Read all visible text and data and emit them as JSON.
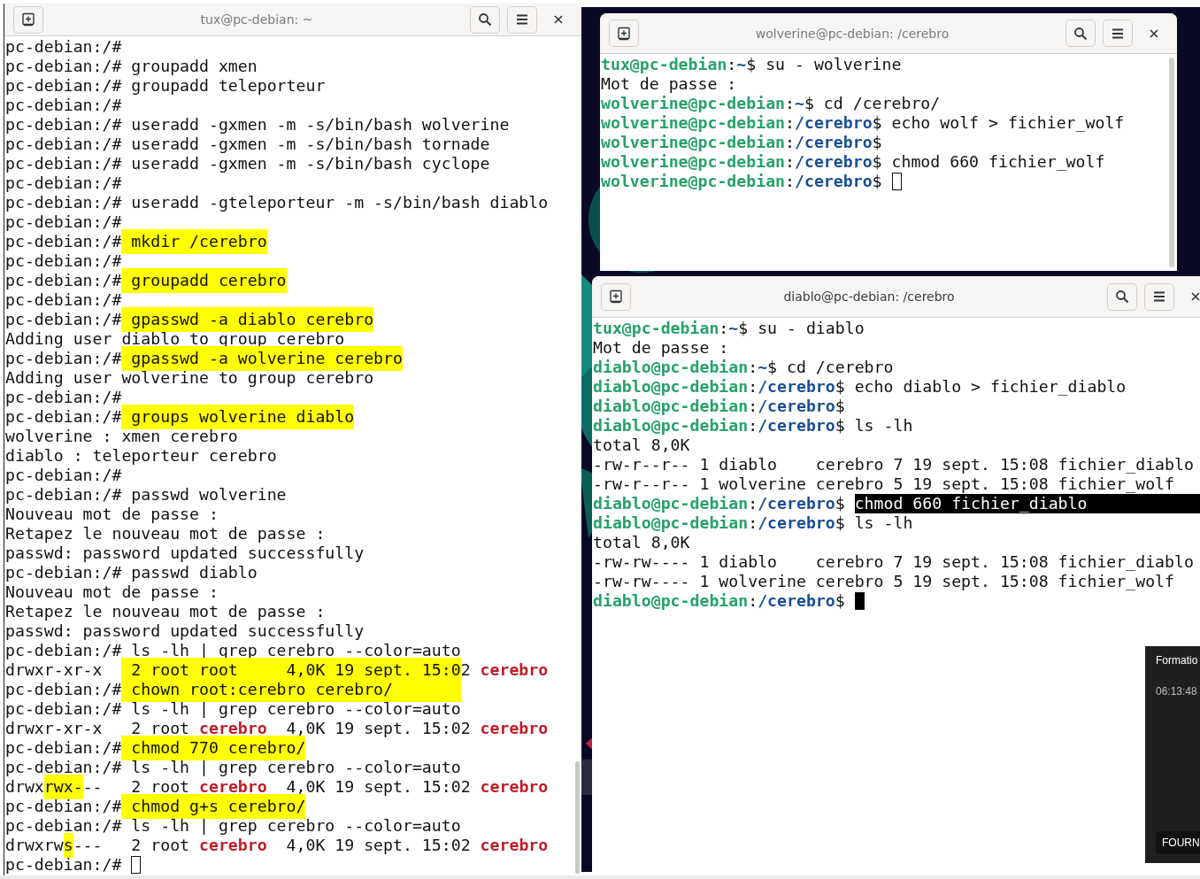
{
  "windows": [
    {
      "title": "tux@pc-debian: ~",
      "lines": [
        [
          {
            "kind": "text",
            "text": "pc-debian:/#"
          }
        ],
        [
          {
            "kind": "text",
            "text": "pc-debian:/# groupadd xmen"
          }
        ],
        [
          {
            "kind": "text",
            "text": "pc-debian:/# groupadd teleporteur"
          }
        ],
        [
          {
            "kind": "text",
            "text": "pc-debian:/#"
          }
        ],
        [
          {
            "kind": "text",
            "text": "pc-debian:/# useradd -gxmen -m -s/bin/bash wolverine"
          }
        ],
        [
          {
            "kind": "text",
            "text": "pc-debian:/# useradd -gxmen -m -s/bin/bash tornade"
          }
        ],
        [
          {
            "kind": "text",
            "text": "pc-debian:/# useradd -gxmen -m -s/bin/bash cyclope"
          }
        ],
        [
          {
            "kind": "text",
            "text": "pc-debian:/#"
          }
        ],
        [
          {
            "kind": "text",
            "text": "pc-debian:/# useradd -gteleporteur -m -s/bin/bash diablo"
          }
        ],
        [
          {
            "kind": "text",
            "text": "pc-debian:/#"
          }
        ],
        [
          {
            "kind": "text",
            "text": "pc-debian:/#"
          },
          {
            "kind": "hl",
            "text": " mkdir /cerebro"
          }
        ],
        [
          {
            "kind": "text",
            "text": "pc-debian:/#"
          }
        ],
        [
          {
            "kind": "text",
            "text": "pc-debian:/#"
          },
          {
            "kind": "hl",
            "text": " groupadd cerebro"
          }
        ],
        [
          {
            "kind": "text",
            "text": "pc-debian:/#"
          }
        ],
        [
          {
            "kind": "text",
            "text": "pc-debian:/#"
          },
          {
            "kind": "hl",
            "text": " gpasswd -a diablo cerebro"
          }
        ],
        [
          {
            "kind": "text",
            "text": "Adding user diablo to group cerebro"
          }
        ],
        [
          {
            "kind": "text",
            "text": "pc-debian:/#"
          },
          {
            "kind": "hl",
            "text": " gpasswd -a wolverine cerebro"
          }
        ],
        [
          {
            "kind": "text",
            "text": "Adding user wolverine to group cerebro"
          }
        ],
        [
          {
            "kind": "text",
            "text": "pc-debian:/#"
          }
        ],
        [
          {
            "kind": "text",
            "text": "pc-debian:/#"
          },
          {
            "kind": "hl",
            "text": " groups wolverine diablo"
          }
        ],
        [
          {
            "kind": "text",
            "text": "wolverine : xmen cerebro"
          }
        ],
        [
          {
            "kind": "text",
            "text": "diablo : teleporteur cerebro"
          }
        ],
        [
          {
            "kind": "text",
            "text": "pc-debian:/#"
          }
        ],
        [
          {
            "kind": "text",
            "text": "pc-debian:/# passwd wolverine"
          }
        ],
        [
          {
            "kind": "text",
            "text": "Nouveau mot de passe :"
          }
        ],
        [
          {
            "kind": "text",
            "text": "Retapez le nouveau mot de passe :"
          }
        ],
        [
          {
            "kind": "text",
            "text": "passwd: password updated successfully"
          }
        ],
        [
          {
            "kind": "text",
            "text": "pc-debian:/# passwd diablo"
          }
        ],
        [
          {
            "kind": "text",
            "text": "Nouveau mot de passe :"
          }
        ],
        [
          {
            "kind": "text",
            "text": "Retapez le nouveau mot de passe :"
          }
        ],
        [
          {
            "kind": "text",
            "text": "passwd: password updated successfully"
          }
        ],
        [
          {
            "kind": "text",
            "text": "pc-debian:/# ls -lh | grep cerebro --color=auto"
          }
        ],
        [
          {
            "kind": "text",
            "text": "drwxr-xr-x  "
          },
          {
            "kind": "hl",
            "text": " 2 root root     4,0K 19 sept. 15:0"
          },
          {
            "kind": "text",
            "text": "2 "
          },
          {
            "kind": "red",
            "text": "cerebro"
          }
        ],
        [
          {
            "kind": "text",
            "text": "pc-debian:/#"
          },
          {
            "kind": "hl",
            "text": " chown root:cerebro cerebro/       "
          }
        ],
        [
          {
            "kind": "text",
            "text": "pc-debian:/# ls -lh | grep cerebro --color=auto"
          }
        ],
        [
          {
            "kind": "text",
            "text": "drwxr-xr-x   2 root "
          },
          {
            "kind": "red",
            "text": "cerebro"
          },
          {
            "kind": "text",
            "text": "  4,0K 19 sept. 15:02 "
          },
          {
            "kind": "red",
            "text": "cerebro"
          }
        ],
        [
          {
            "kind": "text",
            "text": "pc-debian:/#"
          },
          {
            "kind": "hl",
            "text": " chmod 770 cerebro/"
          }
        ],
        [
          {
            "kind": "text",
            "text": "pc-debian:/# ls -lh | grep cerebro --color=auto"
          }
        ],
        [
          {
            "kind": "text",
            "text": "drwx"
          },
          {
            "kind": "hl",
            "text": "rwx-"
          },
          {
            "kind": "text",
            "text": "--   2 root "
          },
          {
            "kind": "red",
            "text": "cerebro"
          },
          {
            "kind": "text",
            "text": "  4,0K 19 sept. 15:02 "
          },
          {
            "kind": "red",
            "text": "cerebro"
          }
        ],
        [
          {
            "kind": "text",
            "text": "pc-debian:/#"
          },
          {
            "kind": "hl",
            "text": " chmod g+s cerebro/"
          }
        ],
        [
          {
            "kind": "text",
            "text": "pc-debian:/# ls -lh | grep cerebro --color=auto"
          }
        ],
        [
          {
            "kind": "text",
            "text": "drwxrw"
          },
          {
            "kind": "hl",
            "text": "s"
          },
          {
            "kind": "text",
            "text": "---   2 root "
          },
          {
            "kind": "red",
            "text": "cerebro"
          },
          {
            "kind": "text",
            "text": "  4,0K 19 sept. 15:02 "
          },
          {
            "kind": "red",
            "text": "cerebro"
          }
        ],
        [
          {
            "kind": "text",
            "text": "pc-debian:/# "
          },
          {
            "kind": "cursor",
            "filled": false
          }
        ]
      ]
    },
    {
      "title": "wolverine@pc-debian: /cerebro",
      "lines": [
        [
          {
            "kind": "user",
            "text": "tux@pc-debian"
          },
          {
            "kind": "text",
            "text": ":"
          },
          {
            "kind": "path",
            "text": "~"
          },
          {
            "kind": "text",
            "text": "$ su - wolverine"
          }
        ],
        [
          {
            "kind": "text",
            "text": "Mot de passe :"
          }
        ],
        [
          {
            "kind": "user",
            "text": "wolverine@pc-debian"
          },
          {
            "kind": "text",
            "text": ":"
          },
          {
            "kind": "path",
            "text": "~"
          },
          {
            "kind": "text",
            "text": "$ cd /cerebro/"
          }
        ],
        [
          {
            "kind": "user",
            "text": "wolverine@pc-debian"
          },
          {
            "kind": "text",
            "text": ":"
          },
          {
            "kind": "path",
            "text": "/cerebro"
          },
          {
            "kind": "text",
            "text": "$ echo wolf > fichier_wolf"
          }
        ],
        [
          {
            "kind": "user",
            "text": "wolverine@pc-debian"
          },
          {
            "kind": "text",
            "text": ":"
          },
          {
            "kind": "path",
            "text": "/cerebro"
          },
          {
            "kind": "text",
            "text": "$"
          }
        ],
        [
          {
            "kind": "user",
            "text": "wolverine@pc-debian"
          },
          {
            "kind": "text",
            "text": ":"
          },
          {
            "kind": "path",
            "text": "/cerebro"
          },
          {
            "kind": "text",
            "text": "$ chmod 660 fichier_wolf"
          }
        ],
        [
          {
            "kind": "user",
            "text": "wolverine@pc-debian"
          },
          {
            "kind": "text",
            "text": ":"
          },
          {
            "kind": "path",
            "text": "/cerebro"
          },
          {
            "kind": "text",
            "text": "$ "
          },
          {
            "kind": "cursor",
            "filled": false
          }
        ]
      ]
    },
    {
      "title": "diablo@pc-debian: /cerebro",
      "lines": [
        [
          {
            "kind": "user",
            "text": "tux@pc-debian"
          },
          {
            "kind": "text",
            "text": ":"
          },
          {
            "kind": "path",
            "text": "~"
          },
          {
            "kind": "text",
            "text": "$ su - diablo"
          }
        ],
        [
          {
            "kind": "text",
            "text": "Mot de passe :"
          }
        ],
        [
          {
            "kind": "user",
            "text": "diablo@pc-debian"
          },
          {
            "kind": "text",
            "text": ":"
          },
          {
            "kind": "path",
            "text": "~"
          },
          {
            "kind": "text",
            "text": "$ cd /cerebro"
          }
        ],
        [
          {
            "kind": "user",
            "text": "diablo@pc-debian"
          },
          {
            "kind": "text",
            "text": ":"
          },
          {
            "kind": "path",
            "text": "/cerebro"
          },
          {
            "kind": "text",
            "text": "$ echo diablo > fichier_diablo"
          }
        ],
        [
          {
            "kind": "user",
            "text": "diablo@pc-debian"
          },
          {
            "kind": "text",
            "text": ":"
          },
          {
            "kind": "path",
            "text": "/cerebro"
          },
          {
            "kind": "text",
            "text": "$"
          }
        ],
        [
          {
            "kind": "user",
            "text": "diablo@pc-debian"
          },
          {
            "kind": "text",
            "text": ":"
          },
          {
            "kind": "path",
            "text": "/cerebro"
          },
          {
            "kind": "text",
            "text": "$ ls -lh"
          }
        ],
        [
          {
            "kind": "text",
            "text": "total 8,0K"
          }
        ],
        [
          {
            "kind": "text",
            "text": "-rw-r--r-- 1 diablo    cerebro 7 19 sept. 15:08 fichier_diablo"
          }
        ],
        [
          {
            "kind": "text",
            "text": "-rw-r--r-- 1 wolverine cerebro 5 19 sept. 15:08 fichier_wolf"
          }
        ],
        [
          {
            "kind": "user",
            "text": "diablo@pc-debian"
          },
          {
            "kind": "text",
            "text": ":"
          },
          {
            "kind": "path",
            "text": "/cerebro"
          },
          {
            "kind": "text",
            "text": "$ "
          },
          {
            "kind": "sel",
            "text": "chmod 660 fichier_diablo"
          }
        ],
        [
          {
            "kind": "user",
            "text": "diablo@pc-debian"
          },
          {
            "kind": "text",
            "text": ":"
          },
          {
            "kind": "path",
            "text": "/cerebro"
          },
          {
            "kind": "text",
            "text": "$ ls -lh"
          }
        ],
        [
          {
            "kind": "text",
            "text": "total 8,0K"
          }
        ],
        [
          {
            "kind": "text",
            "text": "-rw-rw---- 1 diablo    cerebro 7 19 sept. 15:08 fichier_diablo"
          }
        ],
        [
          {
            "kind": "text",
            "text": "-rw-rw---- 1 wolverine cerebro 5 19 sept. 15:08 fichier_wolf"
          }
        ],
        [
          {
            "kind": "user",
            "text": "diablo@pc-debian"
          },
          {
            "kind": "text",
            "text": ":"
          },
          {
            "kind": "path",
            "text": "/cerebro"
          },
          {
            "kind": "text",
            "text": "$ "
          },
          {
            "kind": "cursor",
            "filled": true
          }
        ]
      ]
    }
  ],
  "notification": {
    "title": "Formatio",
    "time": "06:13:48",
    "button": "FOURN"
  }
}
